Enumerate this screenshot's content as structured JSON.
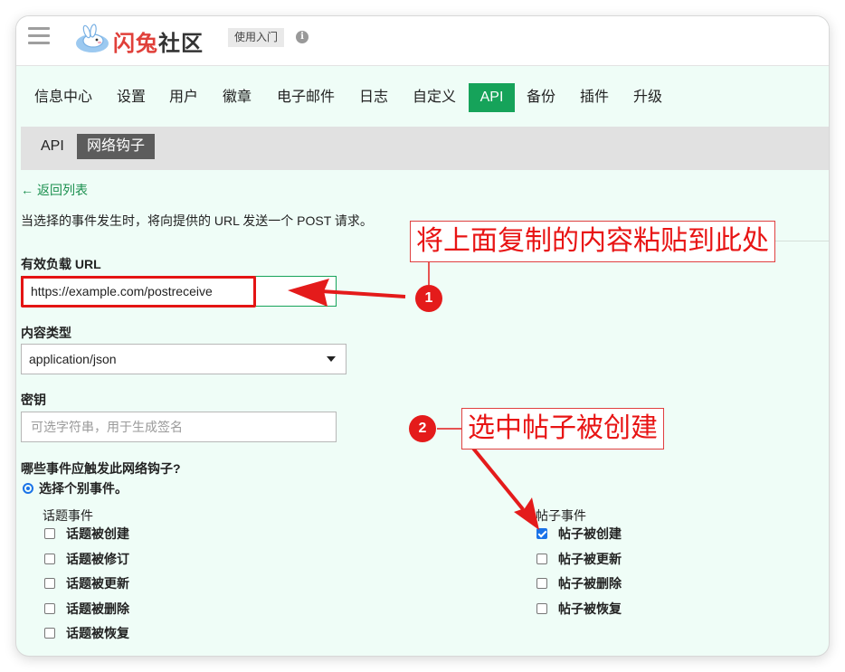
{
  "header": {
    "logo_text_a": "闪兔",
    "logo_text_b": "社区",
    "getting_started_label": "使用入门",
    "info_symbol": "i"
  },
  "nav": {
    "items": [
      {
        "label": "信息中心"
      },
      {
        "label": "设置"
      },
      {
        "label": "用户"
      },
      {
        "label": "徽章"
      },
      {
        "label": "电子邮件"
      },
      {
        "label": "日志"
      },
      {
        "label": "自定义"
      },
      {
        "label": "API",
        "active": true
      },
      {
        "label": "备份"
      },
      {
        "label": "插件"
      },
      {
        "label": "升级"
      }
    ]
  },
  "subnav": {
    "items": [
      {
        "label": "API"
      },
      {
        "label": "网络钩子",
        "active": true
      }
    ]
  },
  "page": {
    "back_link": "返回列表",
    "instructions": "当选择的事件发生时，将向提供的 URL 发送一个 POST 请求。"
  },
  "form": {
    "payload_url": {
      "label": "有效负载 URL",
      "value": "https://example.com/postreceive"
    },
    "content_type": {
      "label": "内容类型",
      "selected": "application/json"
    },
    "secret": {
      "label": "密钥",
      "placeholder": "可选字符串，用于生成签名"
    },
    "events": {
      "question": "哪些事件应触发此网络钩子?",
      "radio_label": "选择个别事件。",
      "topic_group": {
        "title": "话题事件",
        "items": [
          {
            "label": "话题被创建",
            "checked": false
          },
          {
            "label": "话题被修订",
            "checked": false
          },
          {
            "label": "话题被更新",
            "checked": false
          },
          {
            "label": "话题被删除",
            "checked": false
          },
          {
            "label": "话题被恢复",
            "checked": false
          }
        ]
      },
      "post_group": {
        "title": "帖子事件",
        "items": [
          {
            "label": "帖子被创建",
            "checked": true
          },
          {
            "label": "帖子被更新",
            "checked": false
          },
          {
            "label": "帖子被删除",
            "checked": false
          },
          {
            "label": "帖子被恢复",
            "checked": false
          }
        ]
      }
    }
  },
  "annotations": {
    "callout_1": "将上面复制的内容粘贴到此处",
    "badge_1": "1",
    "callout_2": "选中帖子被创建",
    "badge_2": "2",
    "color": "#e41b1b"
  },
  "colors": {
    "accent": "#16a35a",
    "page_bg": "#effdf7",
    "checkbox_blue": "#1a73e8"
  }
}
